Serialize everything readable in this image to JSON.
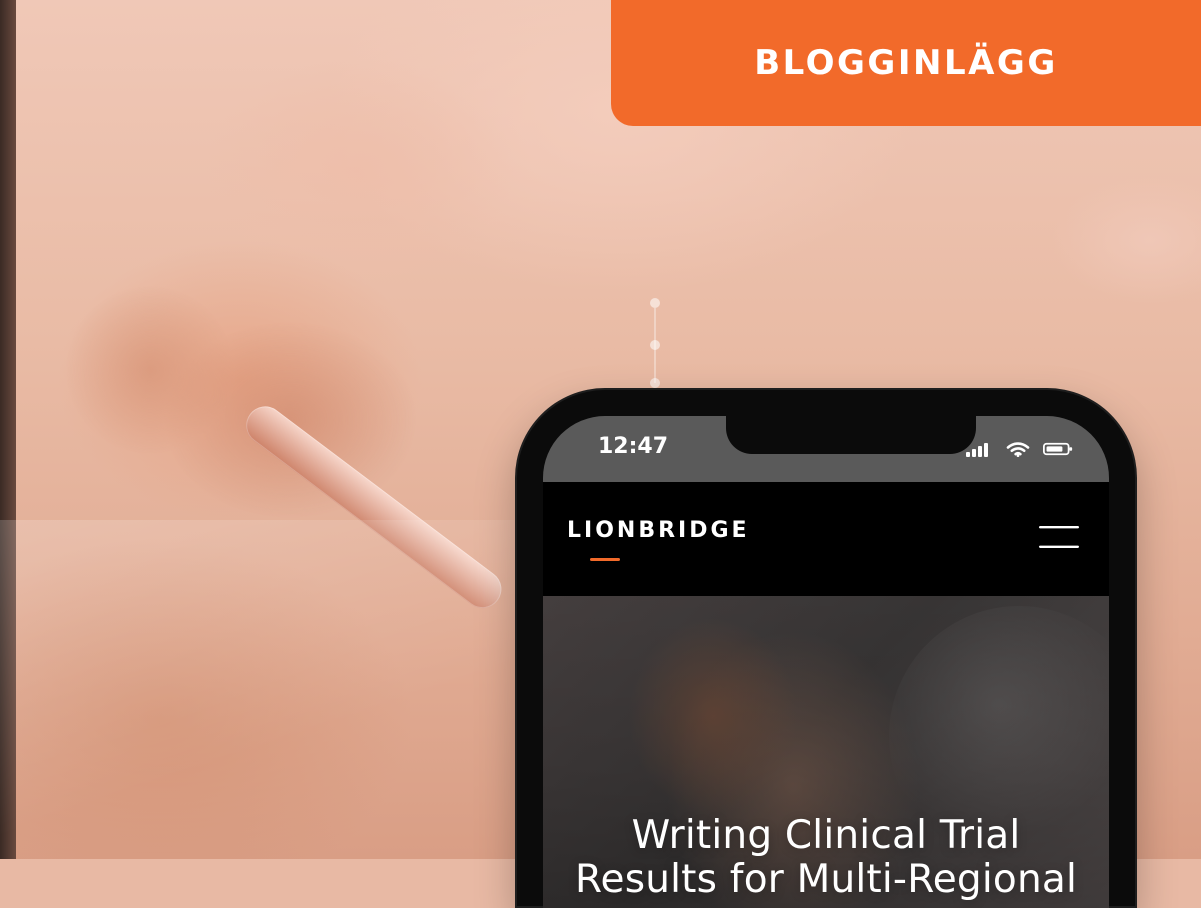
{
  "badge": {
    "label": "BLOGGINLÄGG",
    "color": "#f26a2a"
  },
  "phone": {
    "status_bar": {
      "time": "12:47",
      "icons": [
        "signal-icon",
        "wifi-icon",
        "battery-icon"
      ]
    },
    "app_nav": {
      "brand": "LIONBRIDGE",
      "menu_icon": "hamburger-menu-icon",
      "accent_color": "#f26a2a"
    },
    "hero": {
      "title_lines": [
        "Writing Clinical Trial",
        "Results for Multi-Regional"
      ]
    }
  }
}
